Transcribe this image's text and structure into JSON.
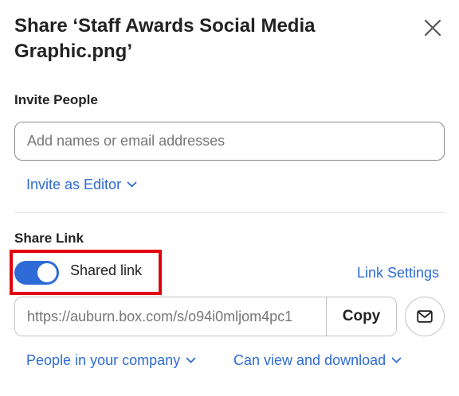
{
  "dialog": {
    "title": "Share ‘Staff Awards Social Media Graphic.png’"
  },
  "invite": {
    "section_label": "Invite People",
    "input_placeholder": "Add names or email addresses",
    "role_label": "Invite as Editor"
  },
  "share_link": {
    "section_label": "Share Link",
    "toggle_label": "Shared link",
    "toggle_on": true,
    "link_settings_label": "Link Settings",
    "url": "https://auburn.box.com/s/o94i0mljom4pc1",
    "copy_label": "Copy",
    "access_scope_label": "People in your company",
    "permission_label": "Can view and download"
  },
  "colors": {
    "accent": "#2e6bd6",
    "highlight": "#e3000f"
  },
  "icons": [
    "close-icon",
    "chevron-down-icon",
    "mail-icon"
  ]
}
